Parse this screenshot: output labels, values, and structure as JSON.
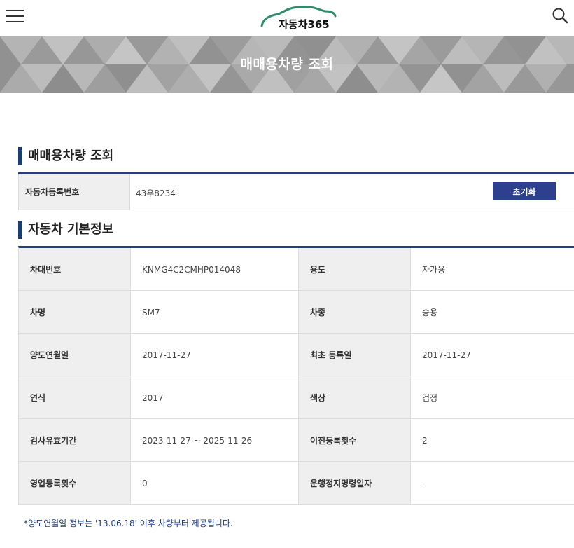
{
  "header": {
    "menu_icon": "hamburger-icon",
    "logo_text": "자동차365",
    "search_icon": "search-icon"
  },
  "banner": {
    "title": "매매용차량 조회"
  },
  "lookup": {
    "heading": "매매용차량 조회",
    "reg_label": "자동차등록번호",
    "reg_value": "43우8234",
    "reset_label": "초기화"
  },
  "basic_info": {
    "heading": "자동차 기본정보",
    "rows": [
      {
        "l1": "차대번호",
        "v1": "KNMG4C2CMHP014048",
        "l2": "용도",
        "v2": "자가용"
      },
      {
        "l1": "차명",
        "v1": "SM7",
        "l2": "차종",
        "v2": "승용"
      },
      {
        "l1": "양도연월일",
        "v1": "2017-11-27",
        "l2": "최초 등록일",
        "v2": "2017-11-27"
      },
      {
        "l1": "연식",
        "v1": "2017",
        "l2": "색상",
        "v2": "검정"
      },
      {
        "l1": "검사유효기간",
        "v1": "2023-11-27 ~ 2025-11-26",
        "l2": "이전등록횟수",
        "v2": "2"
      },
      {
        "l1": "영업등록횟수",
        "v1": "0",
        "l2": "운행정지명령일자",
        "v2": "-"
      }
    ]
  },
  "notice": "*양도연월일 정보는 '13.06.18' 이후 차량부터 제공됩니다.",
  "colors": {
    "accent_navy": "#263e7a",
    "button_blue": "#2d3f8f",
    "logo_green": "#2e8b6e",
    "notice_blue": "#1f3e86"
  }
}
